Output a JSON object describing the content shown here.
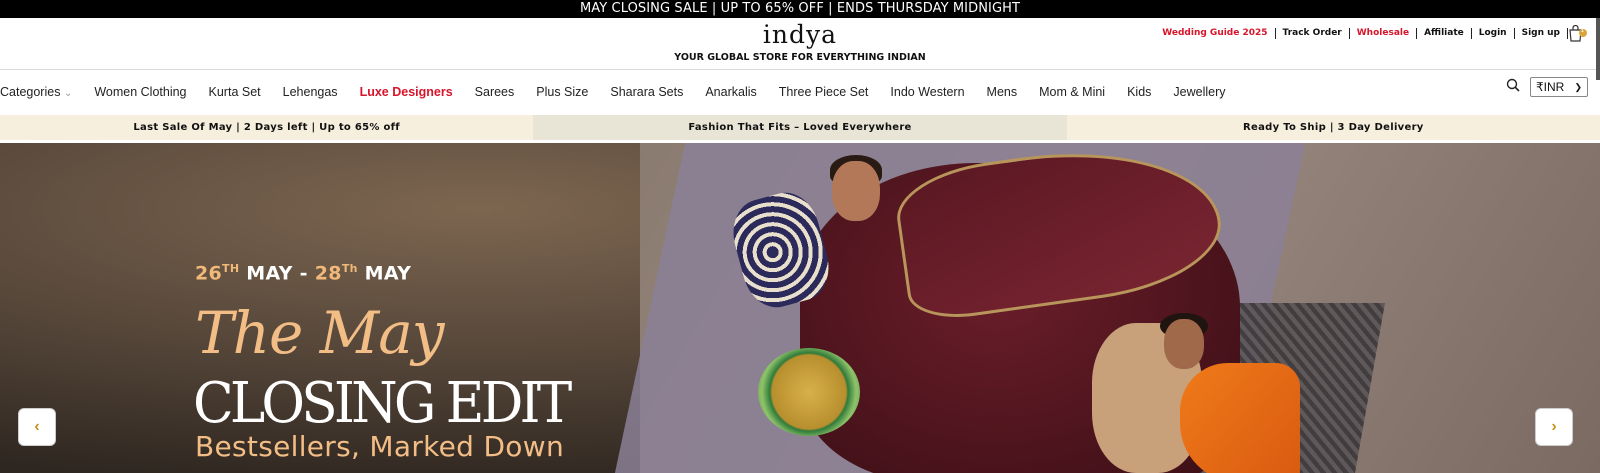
{
  "announcement": "MAY CLOSING SALE | UP TO 65% OFF | ENDS THURSDAY MIDNIGHT",
  "header": {
    "logo": "indya",
    "tagline": "YOUR GLOBAL STORE FOR EVERYTHING INDIAN",
    "links": [
      {
        "label": "Wedding Guide 2025",
        "highlight": true
      },
      {
        "label": "Track Order",
        "highlight": false
      },
      {
        "label": "Wholesale",
        "highlight": true
      },
      {
        "label": "Affiliate",
        "highlight": false
      },
      {
        "label": "Login",
        "highlight": false
      },
      {
        "label": "Sign up",
        "highlight": false
      }
    ],
    "cart_count": "1",
    "cart_icon": "shopping-bag-icon"
  },
  "nav": {
    "items": [
      "Categories",
      "Women Clothing",
      "Kurta Set",
      "Lehengas",
      "Luxe Designers",
      "Sarees",
      "Plus Size",
      "Sharara Sets",
      "Anarkalis",
      "Three Piece Set",
      "Indo Western",
      "Mens",
      "Mom & Mini",
      "Kids",
      "Jewellery"
    ],
    "search_icon": "search-icon",
    "currency": "INR",
    "currency_symbol": "₹"
  },
  "promo_bar": [
    "Last Sale Of May | 2 Days left | Up to 65% off",
    "Fashion That Fits – Loved Everywhere",
    "Ready To Ship | 3 Day Delivery"
  ],
  "hero": {
    "date_start_day": "26",
    "date_start_suffix": "TH",
    "date_start_month": "MAY",
    "date_sep": "-",
    "date_end_day": "28",
    "date_end_suffix": "Th",
    "date_end_month": "MAY",
    "script_title": "The May",
    "title": "CLOSING EDIT",
    "subtitle": "Bestsellers, Marked Down",
    "prev_icon": "chevron-left-icon",
    "next_icon": "chevron-right-icon"
  },
  "colors": {
    "accent_red": "#d8142a",
    "gold": "#f3bd86",
    "promo_bg": "#f6efdd"
  }
}
